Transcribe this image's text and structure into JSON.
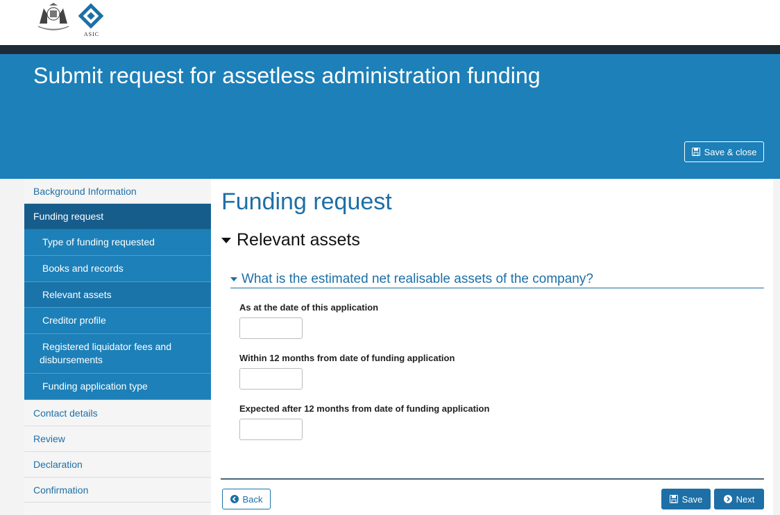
{
  "header": {
    "logo_text": "ASIC",
    "title": "Submit request for assetless administration funding",
    "save_close_label": "Save & close"
  },
  "sidebar": {
    "items": [
      {
        "label": "Background Information"
      },
      {
        "label": "Funding request"
      },
      {
        "label": "Contact details"
      },
      {
        "label": "Review"
      },
      {
        "label": "Declaration"
      },
      {
        "label": "Confirmation"
      }
    ],
    "sub_items": [
      {
        "label": "Type of funding requested"
      },
      {
        "label": "Books and records"
      },
      {
        "label": "Relevant assets"
      },
      {
        "label": "Creditor profile"
      },
      {
        "label": "Registered liquidator fees and disbursements"
      },
      {
        "label": "Funding application type"
      }
    ],
    "active_item": "Funding request",
    "current_sub_item": "Relevant assets"
  },
  "main": {
    "title": "Funding request",
    "section_title": "Relevant assets",
    "question": "What is the estimated net realisable assets of the company?",
    "fields": [
      {
        "label": "As at the date of this application",
        "value": ""
      },
      {
        "label": "Within 12 months from date of funding application",
        "value": ""
      },
      {
        "label": "Expected after 12 months from date of funding application",
        "value": ""
      }
    ]
  },
  "footer": {
    "back_label": "Back",
    "save_label": "Save",
    "next_label": "Next"
  },
  "colors": {
    "hero_blue": "#1d80b8",
    "nav_active": "#165d8c",
    "link_blue": "#1d6fa6",
    "dark_strip": "#1d2b36"
  }
}
